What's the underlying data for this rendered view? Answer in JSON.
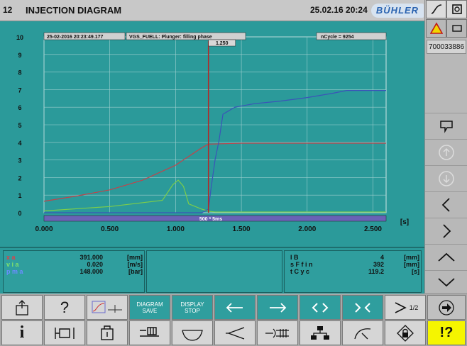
{
  "header": {
    "screen_number": "12",
    "title": "INJECTION DIAGRAM",
    "datetime": "25.02.16 20:24",
    "brand": "BÜHLER"
  },
  "right_panel": {
    "serial": "700033886"
  },
  "chart_data": {
    "type": "line",
    "title": "VGS_FUELL: Plunger: filling phase",
    "timestamp": "25-02-2016 20:23:49.177",
    "cycle": "nCycle = 9254",
    "cursor_value": "1.250",
    "cursor_x": 1.25,
    "scale_label": "500 * 5ms",
    "xlabel": "[s]",
    "xlim": [
      0,
      2.6
    ],
    "ylim": [
      0,
      10
    ],
    "x_ticks": [
      "0.000",
      "0.500",
      "1.000",
      "1.500",
      "2.000",
      "2.500"
    ],
    "y_ticks": [
      "0",
      "1",
      "2",
      "3",
      "4",
      "5",
      "6",
      "7",
      "8",
      "9",
      "10"
    ],
    "series": [
      {
        "color": "#c2434a",
        "x": [
          0,
          0.25,
          0.5,
          0.75,
          1.0,
          1.1,
          1.2,
          1.25,
          1.5,
          2.0,
          2.5,
          2.6
        ],
        "y": [
          0.65,
          0.95,
          1.3,
          1.85,
          2.7,
          3.2,
          3.7,
          3.9,
          3.95,
          3.95,
          3.95,
          3.95
        ]
      },
      {
        "color": "#7ccd4a",
        "x": [
          0,
          0.5,
          0.9,
          0.98,
          1.02,
          1.06,
          1.1,
          1.2,
          1.25,
          1.3,
          1.5,
          2.6
        ],
        "y": [
          0.1,
          0.35,
          0.7,
          1.6,
          1.85,
          1.5,
          0.5,
          0.2,
          0.08,
          0.04,
          0.04,
          0.04
        ]
      },
      {
        "color": "#3b54b8",
        "x": [
          0,
          1.2,
          1.25,
          1.27,
          1.3,
          1.33,
          1.36,
          1.45,
          1.6,
          1.8,
          2.0,
          2.2,
          2.3,
          2.6
        ],
        "y": [
          0,
          0,
          0.2,
          1.4,
          3.0,
          4.1,
          5.6,
          6.0,
          6.2,
          6.35,
          6.55,
          6.8,
          6.95,
          6.95
        ]
      }
    ]
  },
  "info": {
    "left": [
      {
        "label": "x  a",
        "value": "391.000",
        "unit": "[mm]",
        "label_color": "#d8424a"
      },
      {
        "label": "v  i     a",
        "value": "0.020",
        "unit": "[m/s]",
        "label_color": "#7fe06b"
      },
      {
        "label": "p  m     a",
        "value": "148.000",
        "unit": "[bar]",
        "label_color": "#6c8cff"
      }
    ],
    "right": [
      {
        "label": "I   B",
        "value": "4",
        "unit": "[mm]"
      },
      {
        "label": "s   F f i n",
        "value": "392",
        "unit": "[mm]"
      },
      {
        "label": "t   C y c",
        "value": "119.2",
        "unit": "[s]"
      }
    ]
  },
  "toolbar": {
    "diagram_save": "DIAGRAM SAVE",
    "display_stop": "DISPLAY STOP",
    "page_indicator": "1/2",
    "help": "?",
    "info": "i",
    "help_context": "!?"
  }
}
